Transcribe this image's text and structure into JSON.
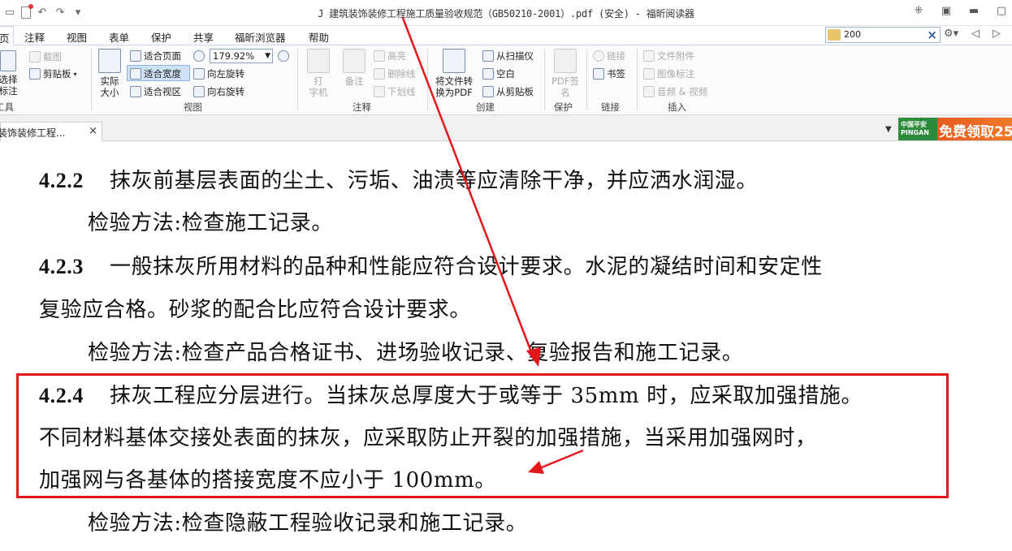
{
  "window": {
    "title": "J 建筑装饰装修工程施工质量验收规范（GB50210-2001）.pdf (安全) - 福昕阅读器"
  },
  "menu": {
    "partial_left": "页",
    "tabs": [
      "注释",
      "视图",
      "表单",
      "保护",
      "共享",
      "福昕浏览器",
      "帮助"
    ]
  },
  "search": {
    "value": "200"
  },
  "ribbon": {
    "tools": {
      "select_label_1": "选择",
      "select_label_2": "标注",
      "group": "工具",
      "screenshot": "截图",
      "clipboard": "剪贴板"
    },
    "view": {
      "actual_size_1": "实际",
      "actual_size_2": "大小",
      "fit_page": "适合页面",
      "fit_width": "适合宽度",
      "fit_visible": "适合视区",
      "zoom": "179.92%",
      "rotate_left": "向左旋转",
      "rotate_right": "向右旋转",
      "group": "视图"
    },
    "comment": {
      "typewriter_1": "打",
      "typewriter_2": "字机",
      "note": "备注",
      "highlight": "高亮",
      "strikeout": "删除线",
      "underline": "下划线",
      "group": "注释"
    },
    "create": {
      "convert_1": "将文件转",
      "convert_2": "换为PDF",
      "from_scanner": "从扫描仪",
      "blank": "空白",
      "from_clipboard": "从剪贴板",
      "group": "创建"
    },
    "protect": {
      "sign_1": "PDF签",
      "sign_2": "名",
      "group": "保护"
    },
    "links": {
      "link": "链接",
      "bookmark": "书签",
      "group": "链接"
    },
    "insert": {
      "attachment": "文件附件",
      "image": "图像标注",
      "audio_video": "音频 & 视频",
      "group": "插入"
    }
  },
  "doc_tab": {
    "label": "装饰装修工程..."
  },
  "ad": {
    "logo_1": "中国平安",
    "logo_2": "PINGAN",
    "text": "免费领取25"
  },
  "content": {
    "l1_num": "4.2.2",
    "l1_text": "抹灰前基层表面的尘土、污垢、油渍等应清除干净，并应洒水润湿。",
    "l2_text": "检验方法:检查施工记录。",
    "l3_num": "4.2.3",
    "l3_text": "一般抹灰所用材料的品种和性能应符合设计要求。水泥的凝结时间和安定性",
    "l4_text": "复验应合格。砂浆的配合比应符合设计要求。",
    "l5_text": "检验方法:检查产品合格证书、进场验收记录、复验报告和施工记录。",
    "l6_num": "4.2.4",
    "l6_text": "抹灰工程应分层进行。当抹灰总厚度大于或等于 35mm 时，应采取加强措施。",
    "l7_text": "不同材料基体交接处表面的抹灰，应采取防止开裂的加强措施，当采用加强网时，",
    "l8_text": "加强网与各基体的搭接宽度不应小于 100mm。",
    "l9_text": "检验方法:检查隐蔽工程验收记录和施工记录。"
  },
  "colors": {
    "annotation_red": "#e3161c",
    "ribbon_bg": "#fbfbfb",
    "highlight_blue": "#cfe1f7"
  }
}
